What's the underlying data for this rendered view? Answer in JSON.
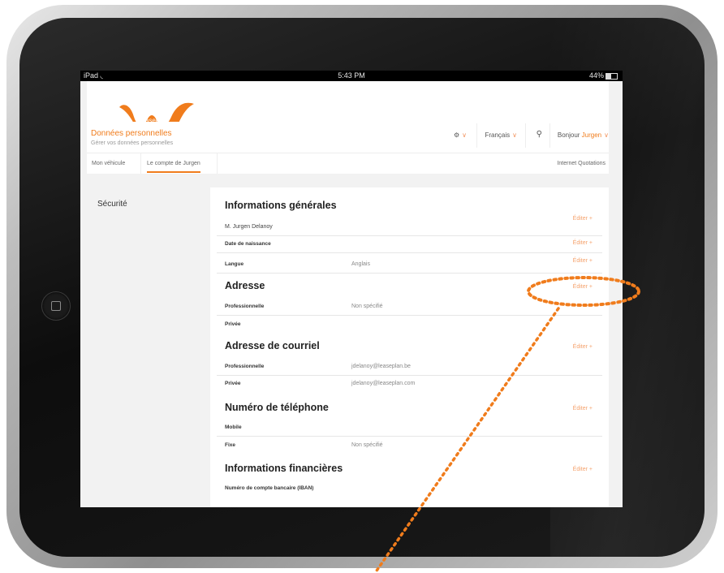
{
  "status_bar": {
    "device": "iPad",
    "time": "5:43 PM",
    "battery": "44%",
    "battery_level": 0.44
  },
  "header": {
    "logo_text": "LeasePlan",
    "language": "Français",
    "greeting": "Bonjour",
    "user_name": "Jurgen"
  },
  "nav": {
    "tab1": "Mon véhicule",
    "tab2": "Le compte de Jurgen",
    "right_link": "Internet Quotations"
  },
  "sidebar": {
    "security": "Sécurité",
    "personal_title": "Données personnelles",
    "personal_sub": "Gérer vos données personnelles"
  },
  "edit_label": "Éditer +",
  "sections": {
    "general": {
      "title": "Informations générales",
      "name": "M. Jurgen Delanoy",
      "birth_label": "Date de naissance",
      "lang_label": "Langue",
      "lang_value": "Anglais"
    },
    "address": {
      "title": "Adresse",
      "pro_label": "Professionnelle",
      "pro_value": "Non spécifié",
      "priv_label": "Privée"
    },
    "email": {
      "title": "Adresse de courriel",
      "pro_label": "Professionnelle",
      "pro_value": "jdelanoy@leaseplan.be",
      "priv_label": "Privée",
      "priv_value": "jdelanoy@leaseplan.com"
    },
    "phone": {
      "title": "Numéro de téléphone",
      "mobile_label": "Mobile",
      "fixe_label": "Fixe",
      "fixe_value": "Non spécifié"
    },
    "financial": {
      "title": "Informations financières",
      "iban_label": "Numéro de compte bancaire (IBAN)"
    }
  },
  "colors": {
    "accent": "#f07c1c",
    "edit": "#f5a36e",
    "annotation": "#f07c1c"
  }
}
